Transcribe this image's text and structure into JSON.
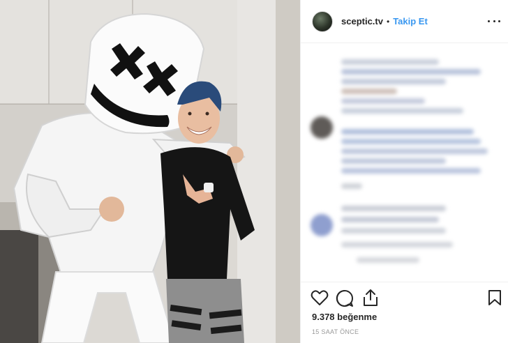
{
  "header": {
    "username": "sceptic.tv",
    "separator": "•",
    "follow_label": "Takip Et"
  },
  "post": {
    "likes_label": "9.378 beğenme",
    "timestamp": "15 SAAT ÖNCE"
  },
  "icons": {
    "like": "heart-icon",
    "comment": "comment-icon",
    "share": "share-icon",
    "save": "bookmark-icon",
    "more": "more-options-icon"
  },
  "colors": {
    "accent": "#3897f0",
    "text": "#262626",
    "muted": "#999999",
    "border": "#efefef"
  }
}
